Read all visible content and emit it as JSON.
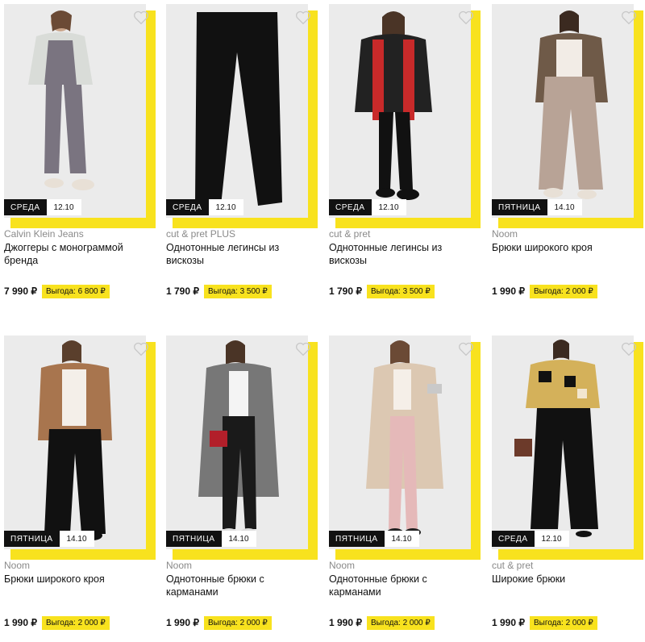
{
  "products": [
    {
      "day": "Среда",
      "date": "12.10",
      "brand": "Calvin Klein Jeans",
      "title": "Джоггеры с монограммой бренда",
      "price": "7 990 ₽",
      "benefit": "Выгода: 6 800 ₽",
      "heart": true,
      "image": "model-joggers-grey"
    },
    {
      "day": "Среда",
      "date": "12.10",
      "brand": "cut & pret PLUS",
      "title": "Однотонные легинсы из вискозы",
      "price": "1 790 ₽",
      "benefit": "Выгода: 3 500 ₽",
      "heart": true,
      "image": "black-leggings-flat"
    },
    {
      "day": "Среда",
      "date": "12.10",
      "brand": "cut & pret",
      "title": "Однотонные легинсы из вискозы",
      "price": "1 790 ₽",
      "benefit": "Выгода: 3 500 ₽",
      "heart": true,
      "image": "model-leggings-black"
    },
    {
      "day": "Пятница",
      "date": "14.10",
      "brand": "Noom",
      "title": "Брюки широкого кроя",
      "price": "1 990 ₽",
      "benefit": "Выгода: 2 000 ₽",
      "heart": true,
      "image": "model-wide-trousers-beige"
    },
    {
      "day": "Пятница",
      "date": "14.10",
      "brand": "Noom",
      "title": "Брюки широкого кроя",
      "price": "1 990 ₽",
      "benefit": "Выгода: 2 000 ₽",
      "heart": true,
      "image": "model-wide-trousers-black"
    },
    {
      "day": "Пятница",
      "date": "14.10",
      "brand": "Noom",
      "title": "Однотонные брюки с карманами",
      "price": "1 990 ₽",
      "benefit": "Выгода: 2 000 ₽",
      "heart": true,
      "image": "model-trousers-black-houndstooth"
    },
    {
      "day": "Пятница",
      "date": "14.10",
      "brand": "Noom",
      "title": "Однотонные брюки с карманами",
      "price": "1 990 ₽",
      "benefit": "Выгода: 2 000 ₽",
      "heart": true,
      "image": "model-trousers-pink"
    },
    {
      "day": "Среда",
      "date": "12.10",
      "brand": "cut & pret",
      "title": "Широкие брюки",
      "price": "1 990 ₽",
      "benefit": "Выгода: 2 000 ₽",
      "heart": true,
      "image": "model-wide-trousers-black-print"
    }
  ],
  "colors": {
    "accent": "#f8e21e",
    "badge_bg": "#111111",
    "brand_text": "#8a8a8a"
  }
}
